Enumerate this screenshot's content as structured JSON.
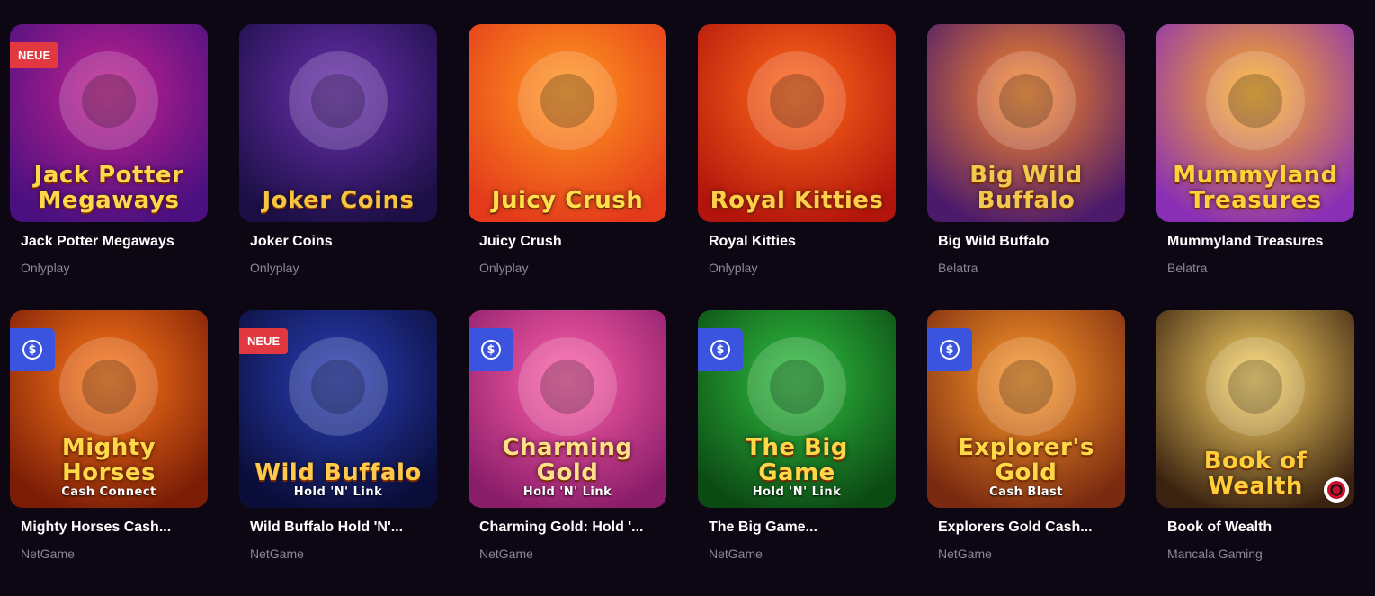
{
  "games": [
    {
      "name": "Jack Potter Megaways",
      "provider": "Onlyplay",
      "art": "Jack Potter Megaways",
      "badge": "NEUE",
      "bg": [
        "#c2218f",
        "#4a1080"
      ],
      "accent": "#ffd84a"
    },
    {
      "name": "Joker Coins",
      "provider": "Onlyplay",
      "art": "Joker Coins",
      "badge": "",
      "bg": [
        "#6a2fb0",
        "#1c0f45"
      ],
      "accent": "#f5c542"
    },
    {
      "name": "Juicy Crush",
      "provider": "Onlyplay",
      "art": "Juicy Crush",
      "badge": "",
      "bg": [
        "#ff9a1f",
        "#e43a1b"
      ],
      "accent": "#ffe04a"
    },
    {
      "name": "Royal Kitties",
      "provider": "Onlyplay",
      "art": "Royal Kitties",
      "badge": "",
      "bg": [
        "#ff6a1a",
        "#b3150c"
      ],
      "accent": "#ffcf4a"
    },
    {
      "name": "Big Wild Buffalo",
      "provider": "Belatra",
      "art": "Big Wild Buffalo",
      "badge": "",
      "bg": [
        "#ff8a2a",
        "#4b1a6b"
      ],
      "accent": "#f2c94c"
    },
    {
      "name": "Mummyland Treasures",
      "provider": "Belatra",
      "art": "Mummyland Treasures",
      "badge": "",
      "bg": [
        "#ffb21f",
        "#8a2fb5"
      ],
      "accent": "#ffd23a"
    },
    {
      "name": "Mighty Horses Cash...",
      "provider": "NetGame",
      "art": "Mighty Horses",
      "art_sub": "Cash Connect",
      "badge": "cash",
      "bg": [
        "#ff7a1a",
        "#7a1c06"
      ],
      "accent": "#ffd84a"
    },
    {
      "name": "Wild Buffalo Hold 'N'...",
      "provider": "NetGame",
      "art": "Wild Buffalo",
      "art_sub": "Hold 'N' Link",
      "badge": "NEUE",
      "bg": [
        "#2a3fb8",
        "#0a0d38"
      ],
      "accent": "#ffc94a"
    },
    {
      "name": "Charming Gold: Hold '...",
      "provider": "NetGame",
      "art": "Charming Gold",
      "art_sub": "Hold 'N' Link",
      "badge": "cash",
      "bg": [
        "#ff5fa8",
        "#8a1d6a"
      ],
      "accent": "#ffe08a"
    },
    {
      "name": "The Big Game...",
      "provider": "NetGame",
      "art": "The Big Game",
      "art_sub": "Hold 'N' Link",
      "badge": "cash",
      "bg": [
        "#2fbf3f",
        "#0c4a14"
      ],
      "accent": "#ffd84a"
    },
    {
      "name": "Explorers Gold Cash...",
      "provider": "NetGame",
      "art": "Explorer's Gold",
      "art_sub": "Cash Blast",
      "badge": "cash",
      "bg": [
        "#ff9a2a",
        "#7a2a10"
      ],
      "accent": "#ffd84a"
    },
    {
      "name": "Book of Wealth",
      "provider": "Mancala Gaming",
      "art": "Book of Wealth",
      "badge": "",
      "bg": [
        "#ffd866",
        "#3a2210"
      ],
      "accent": "#ffcf3a",
      "chip": true
    }
  ],
  "icons": {
    "cash_badge": "dollar-coin-icon",
    "provider_chip": "mancala-logo-icon"
  }
}
